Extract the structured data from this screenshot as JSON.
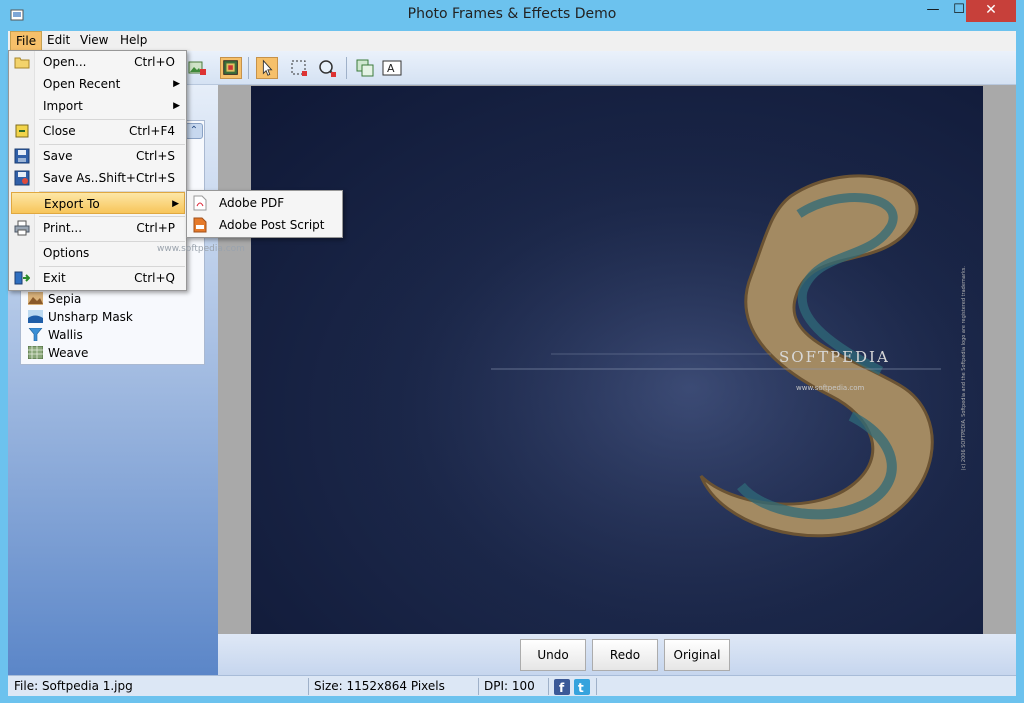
{
  "window": {
    "title": "Photo Frames & Effects Demo",
    "min_glyph": "—",
    "max_glyph": "☐",
    "close_glyph": "✕"
  },
  "menubar": {
    "items": [
      {
        "label": "File",
        "active": true
      },
      {
        "label": "Edit"
      },
      {
        "label": "View"
      },
      {
        "label": "Help"
      }
    ]
  },
  "file_menu": {
    "items": [
      {
        "label": "Open...",
        "shortcut": "Ctrl+O",
        "icon": "open-folder-icon"
      },
      {
        "label": "Open Recent",
        "submenu": true
      },
      {
        "label": "Import",
        "submenu": true
      },
      {
        "label": "Close",
        "shortcut": "Ctrl+F4",
        "icon": "close-document-icon"
      },
      {
        "label": "Save",
        "shortcut": "Ctrl+S",
        "icon": "save-icon"
      },
      {
        "label": "Save As...",
        "shortcut": "Shift+Ctrl+S",
        "icon": "save-as-icon"
      },
      {
        "label": "Export To",
        "submenu": true,
        "highlighted": true
      },
      {
        "label": "Print...",
        "shortcut": "Ctrl+P",
        "icon": "printer-icon"
      },
      {
        "label": "Options"
      },
      {
        "label": "Exit",
        "shortcut": "Ctrl+Q",
        "icon": "exit-icon"
      }
    ],
    "arrow_glyph": "▶"
  },
  "export_submenu": {
    "items": [
      {
        "label": "Adobe PDF",
        "icon": "pdf-icon"
      },
      {
        "label": "Adobe Post Script",
        "icon": "postscript-icon"
      }
    ]
  },
  "filters": {
    "collapse_glyph": "⌃",
    "items": [
      {
        "label": "Sepia",
        "icon": "sepia-icon"
      },
      {
        "label": "Unsharp Mask",
        "icon": "unsharp-mask-icon"
      },
      {
        "label": "Wallis",
        "icon": "wallis-icon"
      },
      {
        "label": "Weave",
        "icon": "weave-icon"
      }
    ]
  },
  "photo": {
    "watermark": "SOFTPEDIA",
    "url": "www.softpedia.com",
    "legal": "(c) 2006 SOFTPEDIA. Softpedia and the Softpedia logo are registered trademarks.",
    "ghost_watermark": "www.softpedia.com"
  },
  "actions": {
    "undo": "Undo",
    "redo": "Redo",
    "original": "Original"
  },
  "status": {
    "file": "File: Softpedia 1.jpg",
    "size": "Size: 1152x864 Pixels",
    "dpi": "DPI: 100"
  },
  "colors": {
    "accent": "#f6c06a",
    "title_bar": "#6cc2ee",
    "close": "#c7403a"
  }
}
